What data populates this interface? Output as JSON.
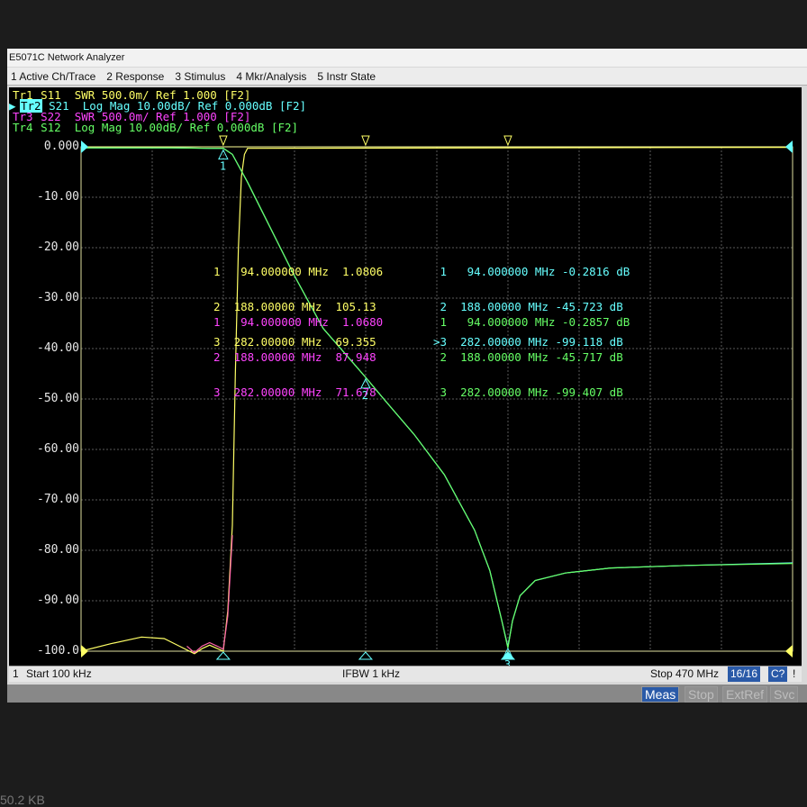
{
  "window": {
    "title": "E5071C Network Analyzer"
  },
  "menu": [
    "1 Active Ch/Trace",
    "2 Response",
    "3 Stimulus",
    "4 Mkr/Analysis",
    "5 Instr State"
  ],
  "traces": [
    {
      "tag": "Tr1",
      "text": " S11  SWR 500.0m/ Ref 1.000 [F2]",
      "color": "#ffff66"
    },
    {
      "tag": "Tr2",
      "text": " S21  Log Mag 10.00dB/ Ref 0.000dB [F2]",
      "color": "#66ffff",
      "active": true
    },
    {
      "tag": "Tr3",
      "text": " S22  SWR 500.0m/ Ref 1.000 [F2]",
      "color": "#ff44ff"
    },
    {
      "tag": "Tr4",
      "text": " S12  Log Mag 10.00dB/ Ref 0.000dB [F2]",
      "color": "#66ff66"
    }
  ],
  "y_labels": [
    "0.000",
    "-10.00",
    "-20.00",
    "-30.00",
    "-40.00",
    "-50.00",
    "-60.00",
    "-70.00",
    "-80.00",
    "-90.00",
    "-100.0"
  ],
  "marker_tables": {
    "tr1": [
      "1   94.000000 MHz  1.0806",
      "2  188.00000 MHz  105.13",
      "3  282.00000 MHz  69.355"
    ],
    "tr2": [
      " 1   94.000000 MHz -0.2816 dB",
      " 2  188.00000 MHz -45.723 dB",
      ">3  282.00000 MHz -99.118 dB"
    ],
    "tr3": [
      "1   94.000000 MHz  1.0680",
      "2  188.00000 MHz  87.948",
      "3  282.00000 MHz  71.678"
    ],
    "tr4": [
      " 1   94.000000 MHz -0.2857 dB",
      " 2  188.00000 MHz -45.717 dB",
      " 3  282.00000 MHz -99.407 dB"
    ]
  },
  "chart_data": {
    "type": "line",
    "x_unit": "MHz",
    "xlim": [
      0.1,
      470
    ],
    "ylim": [
      -100,
      0
    ],
    "grid": true,
    "series": [
      {
        "name": "S21",
        "color": "#66ffff",
        "x": [
          0.1,
          60,
          85,
          94,
          100,
          110,
          120,
          140,
          160,
          188,
          200,
          220,
          240,
          260,
          270,
          278,
          282,
          285,
          290,
          300,
          320,
          350,
          400,
          470
        ],
        "y": [
          -0.2,
          -0.2,
          -0.3,
          -0.28,
          -1.5,
          -7,
          -13,
          -25,
          -36,
          -45.7,
          -50,
          -57,
          -65,
          -76,
          -84,
          -94,
          -99.1,
          -94,
          -89,
          -86,
          -84.5,
          -83.5,
          -83,
          -82.5
        ]
      },
      {
        "name": "S11",
        "color": "#ffff66",
        "x": [
          0.1,
          20,
          40,
          55,
          65,
          75,
          80,
          85,
          94,
          97,
          100,
          102,
          104,
          106,
          108,
          110,
          470
        ],
        "y": [
          -100,
          -98.5,
          -97.2,
          -97.5,
          -99,
          -100.5,
          -99.5,
          -98.8,
          -100,
          -92,
          -75,
          -45,
          -20,
          -6,
          -1.5,
          -0.3,
          -0.1
        ]
      },
      {
        "name": "S22",
        "color": "#ff66aa",
        "x": [
          70,
          75,
          80,
          85,
          90,
          94,
          97,
          100
        ],
        "y": [
          -99,
          -100.3,
          -99,
          -98.3,
          -99,
          -99.6,
          -93,
          -77
        ]
      },
      {
        "name": "S12",
        "color": "#66ff66",
        "x": [
          0.1,
          60,
          85,
          94,
          100,
          110,
          120,
          140,
          160,
          188,
          200,
          220,
          240,
          260,
          270,
          278,
          282,
          285,
          290,
          300,
          320,
          350,
          400,
          470
        ],
        "y": [
          -0.2,
          -0.2,
          -0.3,
          -0.29,
          -1.5,
          -7,
          -13,
          -25,
          -36,
          -45.7,
          -50,
          -57,
          -65,
          -76,
          -84,
          -94,
          -99.4,
          -94,
          -89,
          -86,
          -84.5,
          -83.5,
          -83,
          -82.6
        ]
      }
    ],
    "markers": [
      {
        "label": "1",
        "x": 94
      },
      {
        "label": "2",
        "x": 188
      },
      {
        "label": "3",
        "x": 282
      }
    ]
  },
  "status": {
    "channel": "1",
    "start": "Start 100 kHz",
    "ifbw": "IFBW 1 kHz",
    "stop": "Stop 470 MHz",
    "points": "16/16",
    "cal": "C?",
    "excl": "!"
  },
  "softkeys": [
    "Meas",
    "Stop",
    "ExtRef",
    "Svc"
  ],
  "footer": {
    "filesize": "50.2 KB"
  }
}
